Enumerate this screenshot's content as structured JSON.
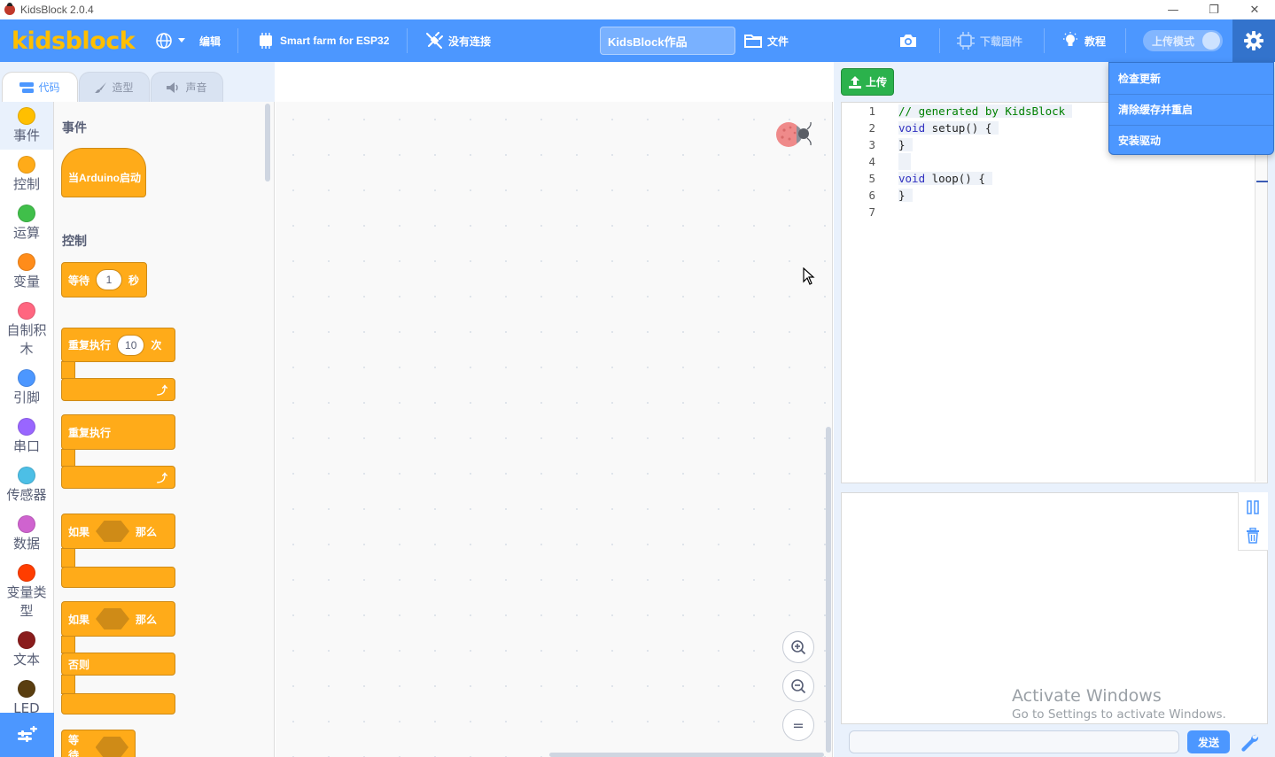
{
  "window": {
    "title": "KidsBlock 2.0.4",
    "controls": [
      "—",
      "❐",
      "✕"
    ]
  },
  "menubar": {
    "logo": "kidsblock",
    "edit_label": "编辑",
    "device_label": "Smart farm for ESP32",
    "connection_label": "没有连接",
    "project_title": "KidsBlock作品",
    "file_label": "文件",
    "download_firmware_label": "下载固件",
    "tutorial_label": "教程",
    "upload_mode_label": "上传模式"
  },
  "settings_menu": {
    "items": [
      "检查更新",
      "清除缓存并重启",
      "安装驱动"
    ]
  },
  "tabs": [
    {
      "label": "代码",
      "active": true
    },
    {
      "label": "造型",
      "active": false
    },
    {
      "label": "声音",
      "active": false
    }
  ],
  "categories": [
    {
      "label": "事件",
      "color": "#ffbf00"
    },
    {
      "label": "控制",
      "color": "#ffab19"
    },
    {
      "label": "运算",
      "color": "#40bf4a"
    },
    {
      "label": "变量",
      "color": "#ff8c1a"
    },
    {
      "label": "自制积木",
      "color": "#ff6680"
    },
    {
      "label": "引脚",
      "color": "#4c97ff"
    },
    {
      "label": "串口",
      "color": "#9966ff"
    },
    {
      "label": "传感器",
      "color": "#4cbfe6"
    },
    {
      "label": "数据",
      "color": "#cf63cf"
    },
    {
      "label": "变量类型",
      "color": "#ff3d00"
    },
    {
      "label": "文本",
      "color": "#8a1c1c"
    },
    {
      "label": "LED",
      "color": "#5a3e10"
    }
  ],
  "flyout": {
    "events_heading": "事件",
    "control_heading": "控制",
    "blocks": {
      "when_start": "当Arduino启动",
      "wait_prefix": "等待",
      "wait_value": "1",
      "wait_suffix": "秒",
      "repeat_prefix": "重复执行",
      "repeat_value": "10",
      "repeat_suffix": "次",
      "forever": "重复执行",
      "if_prefix": "如果",
      "if_then": "那么",
      "if2_prefix": "如果",
      "if2_then": "那么",
      "else_label": "否则",
      "wait_until": "等待"
    }
  },
  "toolbar": {
    "upload_label": "上传"
  },
  "code": {
    "lines": [
      {
        "n": "1",
        "text": "// generated by KidsBlock",
        "kind": "comment"
      },
      {
        "n": "2",
        "kw": "void",
        "rest": " setup() {"
      },
      {
        "n": "3",
        "text": "}",
        "kind": "plain"
      },
      {
        "n": "4",
        "text": "",
        "kind": "plain"
      },
      {
        "n": "5",
        "kw": "void",
        "rest": " loop() {"
      },
      {
        "n": "6",
        "text": "}",
        "kind": "plain"
      },
      {
        "n": "7",
        "text": "",
        "kind": "plain"
      }
    ]
  },
  "serial": {
    "send_label": "发送",
    "input_value": "",
    "watermark_title": "Activate Windows",
    "watermark_sub": "Go to Settings to activate Windows."
  },
  "zoom": {
    "in": "+",
    "out": "−",
    "reset": "="
  }
}
